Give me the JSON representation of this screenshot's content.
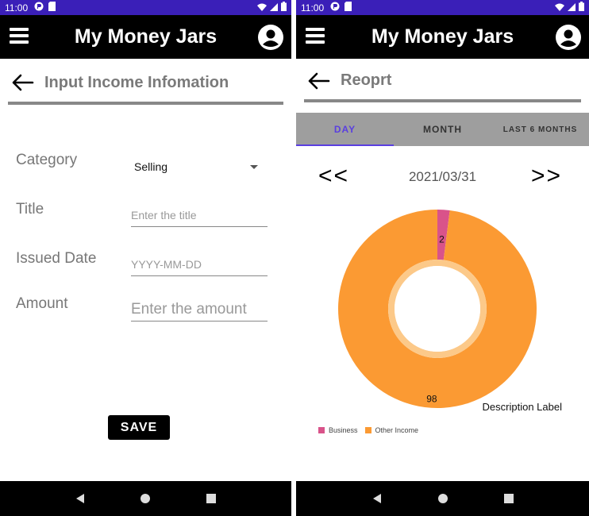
{
  "status_bar": {
    "time": "11:00"
  },
  "app_title": "My Money Jars",
  "left_screen": {
    "page_title": "Input Income Infomation",
    "form": {
      "category_label": "Category",
      "category_value": "Selling",
      "title_label": "Title",
      "title_placeholder": "Enter the title",
      "date_label": "Issued Date",
      "date_placeholder": "YYYY-MM-DD",
      "amount_label": "Amount",
      "amount_placeholder": "Enter the amount"
    },
    "save_label": "SAVE"
  },
  "right_screen": {
    "page_title": "Reoprt",
    "tabs": [
      "DAY",
      "MONTH",
      "LAST 6 MONTHS"
    ],
    "active_tab": "DAY",
    "prev_label": "<<",
    "next_label": ">>",
    "date": "2021/03/31",
    "description_label": "Description Label"
  },
  "colors": {
    "status_bar": "#3a1fb8",
    "app_bar": "#000000",
    "tab_active": "#5a3fe0",
    "business": "#d9538a",
    "other_income": "#fb9a33"
  },
  "icons": {
    "menu": "hamburger-icon",
    "account": "account-circle-icon",
    "back": "arrow-left-icon",
    "dropdown": "caret-down-icon",
    "nav_back": "triangle-left-icon",
    "nav_home": "circle-icon",
    "nav_recents": "square-icon"
  },
  "chart_data": {
    "type": "pie",
    "categories": [
      "Business",
      "Other Income"
    ],
    "values": [
      2,
      98
    ],
    "colors": [
      "#d9538a",
      "#fb9a33"
    ],
    "title": "",
    "legend": "bottom-left",
    "donut": true
  }
}
